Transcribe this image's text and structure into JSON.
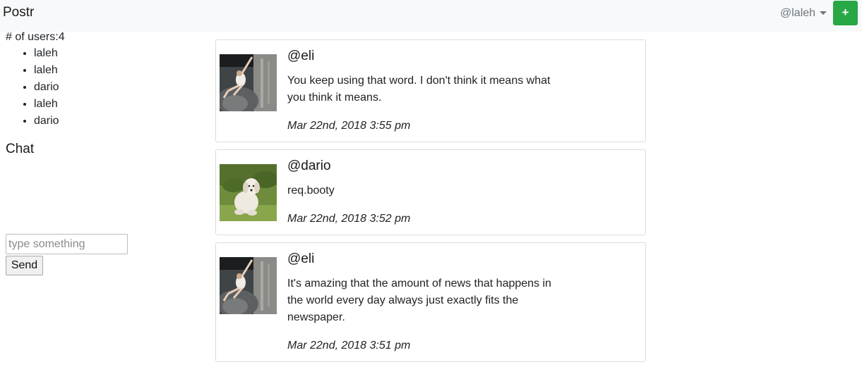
{
  "navbar": {
    "brand": "Postr",
    "username": "@laleh",
    "add_label": "+"
  },
  "sidebar": {
    "users_count_label": "# of users:4",
    "users": [
      "laleh",
      "laleh",
      "dario",
      "laleh",
      "dario"
    ],
    "chat_heading": "Chat",
    "chat_input_placeholder": "type something",
    "send_label": "Send"
  },
  "posts": [
    {
      "handle": "@eli",
      "content": "You keep using that word. I don't think it means what you think it means.",
      "time": "Mar 22nd, 2018 3:55 pm",
      "avatar": "climber-photo"
    },
    {
      "handle": "@dario",
      "content": "req.booty",
      "time": "Mar 22nd, 2018 3:52 pm",
      "avatar": "dog-photo"
    },
    {
      "handle": "@eli",
      "content": "It's amazing that the amount of news that happens in the world every day always just exactly fits the newspaper.",
      "time": "Mar 22nd, 2018 3:51 pm",
      "avatar": "climber-photo"
    }
  ],
  "colors": {
    "navbar_bg": "#f8f9fa",
    "add_button": "#28a745",
    "muted_text": "#6c757d"
  }
}
